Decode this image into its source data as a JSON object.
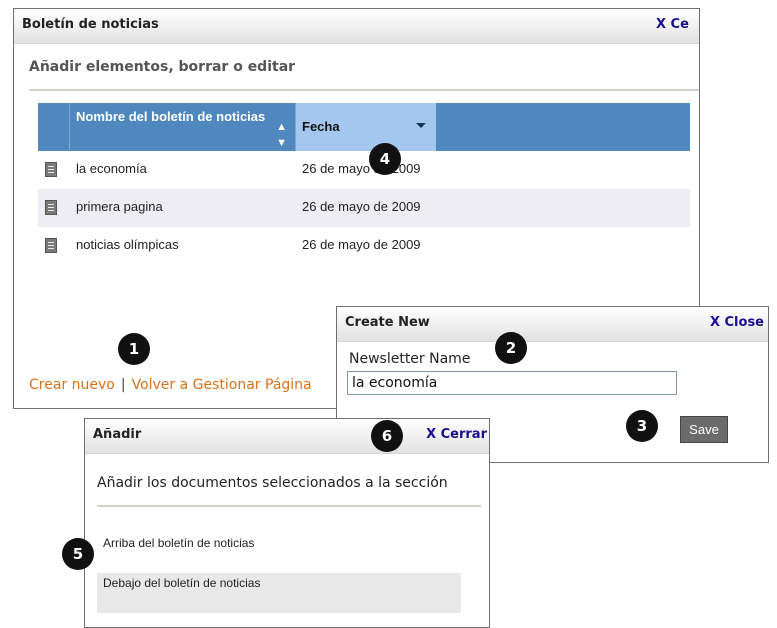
{
  "main_panel": {
    "title": "Boletín de noticias",
    "close_label": "X Ce",
    "subtitle": "Añadir elementos, borrar o editar",
    "table": {
      "columns": [
        "Nombre del boletín de noticias",
        "Fecha"
      ],
      "rows": [
        {
          "name": "la economía",
          "date": "26 de mayo de 2009",
          "icon": "document-icon"
        },
        {
          "name": "primera pagina",
          "date": "26 de mayo de 2009",
          "icon": "document-icon"
        },
        {
          "name": "noticias olímpicas",
          "date": "26 de mayo de 2009",
          "icon": "document-icon"
        }
      ]
    },
    "footer": {
      "create_new": "Crear nuevo",
      "separator": "|",
      "back_link": "Volver a Gestionar Página"
    }
  },
  "create_dialog": {
    "title": "Create New",
    "close_label": "X Close",
    "field_label": "Newsletter Name",
    "field_value": "la economía",
    "save_label": "Save"
  },
  "add_dialog": {
    "title": "Añadir",
    "close_label": "X Cerrar",
    "description": "Añadir los documentos seleccionados a la sección",
    "options": [
      "Arriba del boletín de noticias",
      "Debajo del boletín de noticias"
    ]
  },
  "callouts": [
    "1",
    "2",
    "3",
    "4",
    "5",
    "6"
  ],
  "colors": {
    "header_blue": "#4e88bf",
    "selected_header": "#a3c7ef",
    "link_orange": "#d8731a",
    "close_link": "#1a0f8e",
    "save_button": "#6b6b6b"
  }
}
